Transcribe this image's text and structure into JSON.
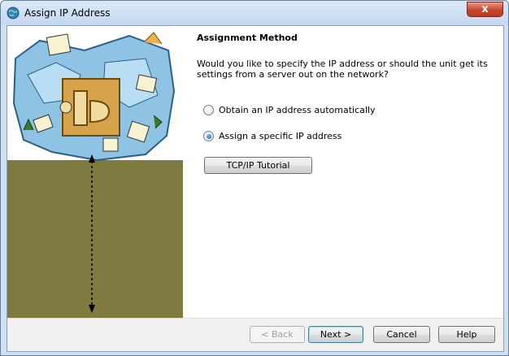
{
  "window": {
    "title": "Assign IP Address",
    "close_label": "x"
  },
  "content": {
    "section_title": "Assignment Method",
    "question": "Would you like to specify the IP address or should the unit get its settings from a server out on the network?",
    "options": [
      {
        "label": "Obtain an IP address automatically",
        "selected": false
      },
      {
        "label": "Assign a specific IP address",
        "selected": true
      }
    ],
    "tutorial_button": "TCP/IP Tutorial"
  },
  "footer": {
    "back": "< Back",
    "next": "Next >",
    "cancel": "Cancel",
    "help": "Help"
  },
  "colors": {
    "side_panel": "#7f7a3f",
    "accent": "#3c7fb1"
  },
  "icons": [
    "globe-network-icon",
    "close-icon",
    "wizard-illustration"
  ]
}
